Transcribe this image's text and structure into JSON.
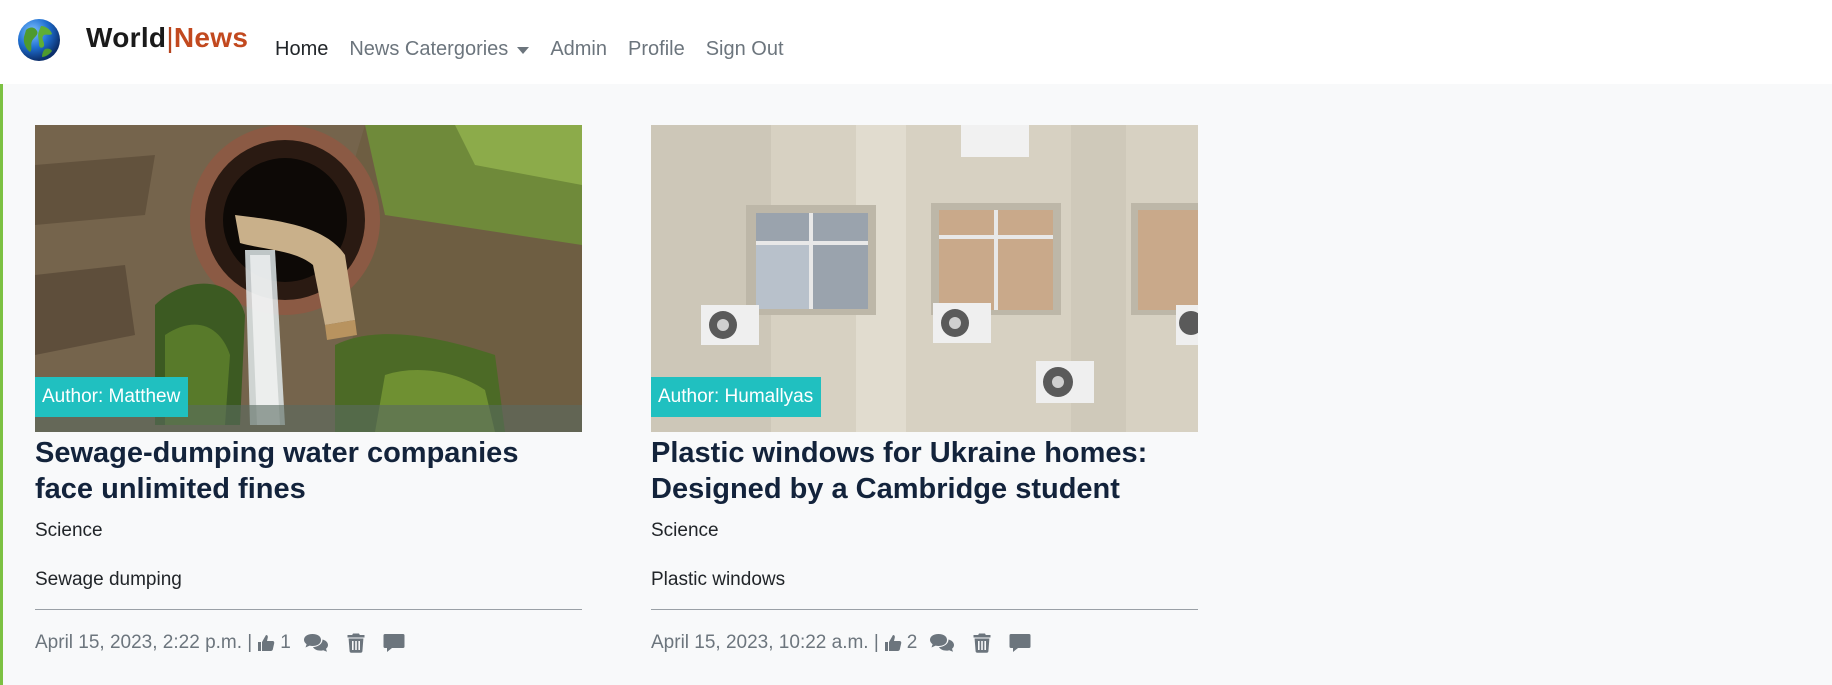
{
  "brand": {
    "part1": "World",
    "separator": "|",
    "part2": "News"
  },
  "nav": {
    "home": "Home",
    "categories": "News Catergories",
    "admin": "Admin",
    "profile": "Profile",
    "signout": "Sign Out"
  },
  "articles": [
    {
      "author": "Author: Matthew",
      "title": "Sewage-dumping water companies face unlimited fines",
      "category": "Science",
      "subtitle": "Sewage dumping",
      "date": "April 15, 2023, 2:22 p.m. |",
      "likes": "1"
    },
    {
      "author": "Author: Humallyas",
      "title": "Plastic windows for Ukraine homes: Designed by a Cambridge student",
      "category": "Science",
      "subtitle": "Plastic windows",
      "date": "April 15, 2023, 10:22 a.m. |",
      "likes": "2"
    }
  ],
  "colors": {
    "accent_badge": "#20c0c0",
    "brand_news": "#c2491f",
    "title": "#13233b",
    "muted": "#6c757d"
  },
  "icons": [
    "globe-logo-icon",
    "thumbs-up-icon",
    "comments-icon",
    "trash-icon",
    "comment-icon",
    "caret-down-icon"
  ]
}
